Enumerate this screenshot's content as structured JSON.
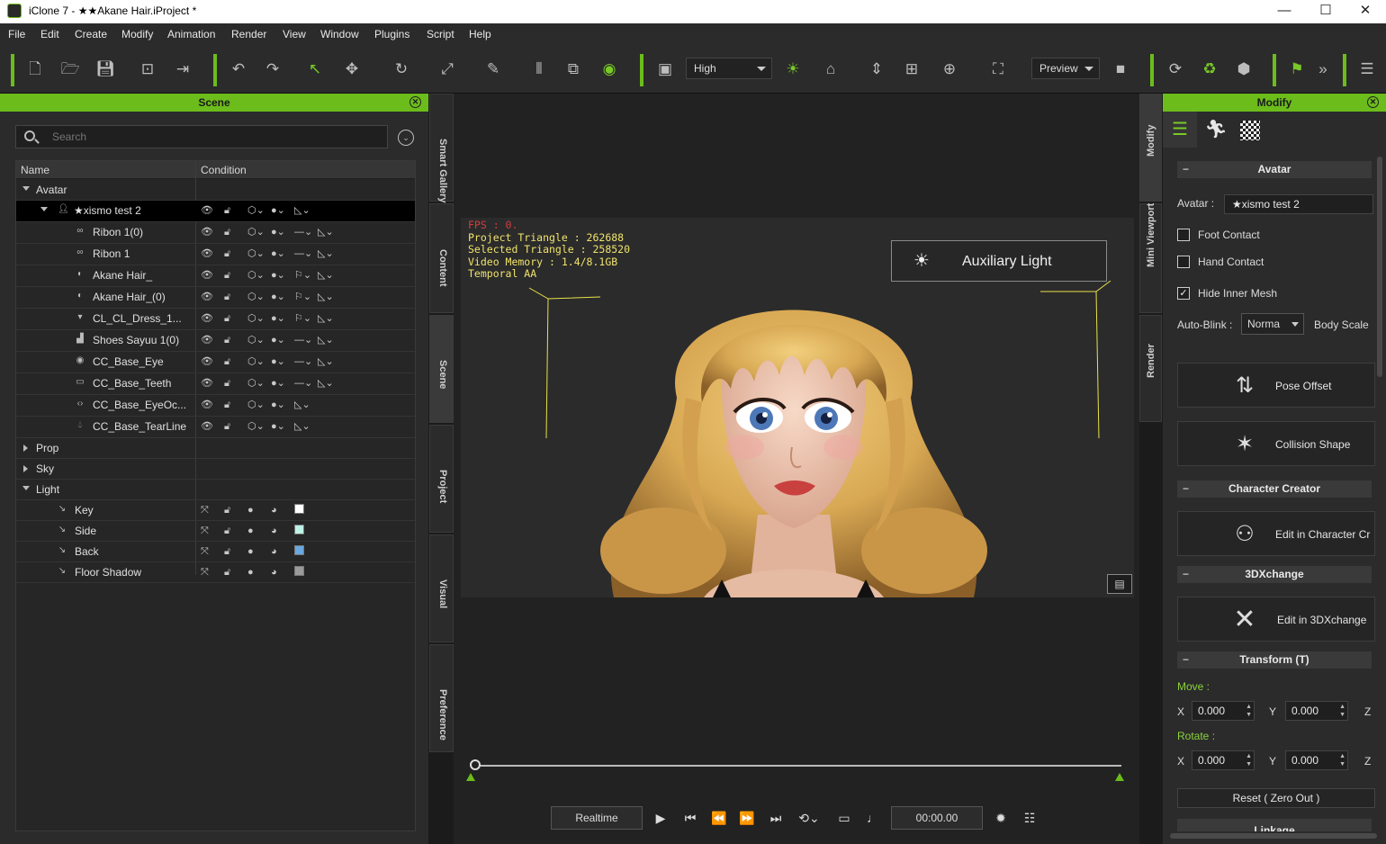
{
  "window": {
    "title": "iClone 7 - ★★Akane Hair.iProject *",
    "controls": [
      "—",
      "☐",
      "✕"
    ]
  },
  "menu": [
    "File",
    "Edit",
    "Create",
    "Modify",
    "Animation",
    "Render",
    "View",
    "Window",
    "Plugins",
    "Script",
    "Help"
  ],
  "toolbar": {
    "quality": "High",
    "preview": "Preview"
  },
  "scene": {
    "title": "Scene",
    "search_placeholder": "Search",
    "col_name": "Name",
    "col_condition": "Condition",
    "groups": {
      "avatar": "Avatar",
      "prop": "Prop",
      "sky": "Sky",
      "light": "Light"
    },
    "avatar_root": "★xismo test 2",
    "avatar_items": [
      "Ribon 1(0)",
      "Ribon 1",
      "Akane Hair_",
      "Akane Hair_(0)",
      "CL_CL_Dress_1...",
      "Shoes Sayuu 1(0)",
      "CC_Base_Eye",
      "CC_Base_Teeth",
      "CC_Base_EyeOc...",
      "CC_Base_TearLine"
    ],
    "lights": [
      {
        "name": "Key",
        "color": "#ffffff"
      },
      {
        "name": "Side",
        "color": "#bff2e6"
      },
      {
        "name": "Back",
        "color": "#6aa8e0"
      },
      {
        "name": "Floor Shadow",
        "color": "#9a9a9a"
      }
    ]
  },
  "left_tabs": [
    "Smart Gallery",
    "Content",
    "Scene",
    "Project",
    "Visual",
    "Preference"
  ],
  "viewport": {
    "fps": "FPS : 0.",
    "triangles": "Project Triangle : 262688",
    "selected": "Selected Triangle : 258520",
    "memory": "Video Memory : 1.4/8.1GB",
    "aa": "Temporal AA",
    "aux_light": "Auxiliary Light"
  },
  "playback": {
    "mode": "Realtime",
    "time": "00:00.00"
  },
  "right_tabs": [
    "Modify",
    "Mini Viewport",
    "Render"
  ],
  "modify": {
    "title": "Modify",
    "avatar_section": "Avatar",
    "avatar_label": "Avatar :",
    "avatar_name": "★xismo test 2",
    "foot_contact": "Foot Contact",
    "hand_contact": "Hand Contact",
    "hide_inner_mesh": "Hide Inner Mesh",
    "auto_blink": "Auto-Blink :",
    "blink_value": "Norma",
    "body_scale": "Body Scale",
    "pose_offset": "Pose Offset",
    "collision_shape": "Collision Shape",
    "cc_section": "Character Creator",
    "edit_cc": "Edit in Character Cr",
    "x3d_section": "3DXchange",
    "edit_3dx": "Edit in 3DXchange",
    "transform_section": "Transform  (T)",
    "move": "Move :",
    "rotate": "Rotate :",
    "x": "X",
    "y": "Y",
    "z": "Z",
    "move_x": "0.000",
    "move_y": "0.000",
    "rot_x": "0.000",
    "rot_y": "0.000",
    "reset": "Reset ( Zero Out )",
    "linkage": "Linkage"
  }
}
